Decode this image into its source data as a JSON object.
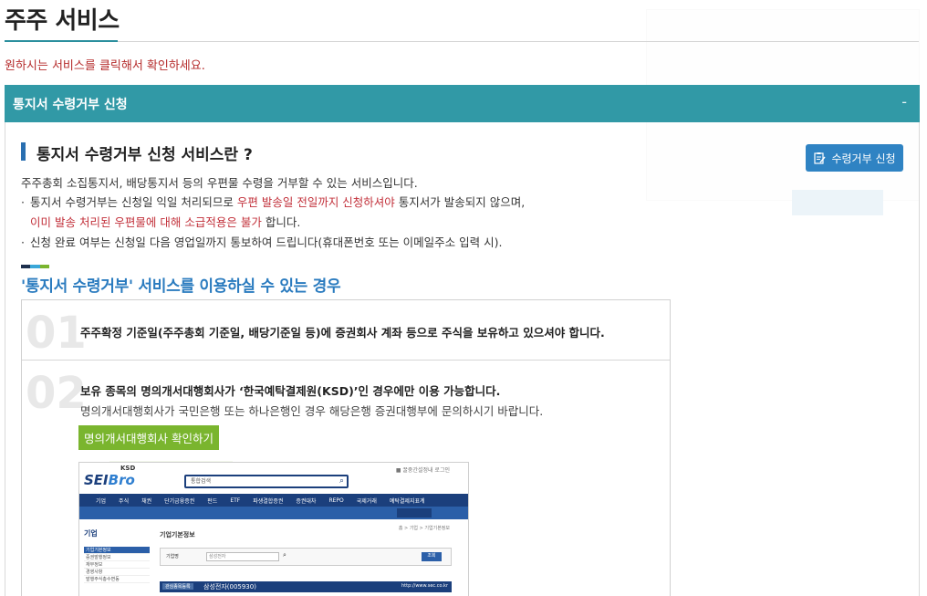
{
  "page": {
    "title": "주주 서비스",
    "instruction": "원하시는 서비스를 클릭해서 확인하세요."
  },
  "accordion": {
    "header": "통지서 수령거부 신청",
    "toggle": "-"
  },
  "section": {
    "title": "통지서 수령거부 신청 서비스란 ?",
    "apply_button": "수령거부 신청",
    "description": "주주총회 소집통지서, 배당통지서 등의 우편물 수령을 거부할 수 있는 서비스입니다.",
    "bullet1_pre": "통지서 수령거부는 신청일 익일 처리되므로 ",
    "bullet1_red": "우편 발송일 전일까지 신청하셔야",
    "bullet1_post": " 통지서가 발송되지 않으며,",
    "bullet1b_red": "이미 발송 처리된 우편물에 대해 소급적용은 불가",
    "bullet1b_post": " 합니다.",
    "bullet2": "신청 완료 여부는 신청일 다음 영업일까지 통보하여 드립니다(휴대폰번호 또는 이메일주소 입력 시).",
    "bullet_mark": "·"
  },
  "conditions": {
    "title": "'통지서 수령거부' 서비스를 이용하실 수 있는 경우",
    "items": [
      {
        "num": "01",
        "text": "주주확정 기준일(주주총회 기준일, 배당기준일 등)에 증권회사 계좌 등으로 주식을 보유하고 있으셔야 합니다."
      },
      {
        "num": "02",
        "text": "보유 종목의 명의개서대행회사가 ‘한국예탁결제원(KSD)’인 경우에만 이용 가능합니다.",
        "sub": "명의개서대행회사가 국민은행 또는 하나은행인 경우 해당은행 증권대행부에 문의하시기 바랍니다.",
        "button": "명의개서대행회사 확인하기"
      }
    ]
  },
  "seibro": {
    "logo_a": "SEI",
    "logo_b": "Bro",
    "ksd": "KSD",
    "search_label": "통합검색",
    "util": "■ 꿀중간설정내 로그인",
    "nav": [
      "기업",
      "주식",
      "채권",
      "단기금융증권",
      "펀드",
      "ETF",
      "파생결합증권",
      "증권대차",
      "REPO",
      "국제거래",
      "예탁결제지표계"
    ],
    "side_title": "기업",
    "side_items": [
      "기업기본정보",
      "증권발행정보",
      "재무정보",
      "경영사항",
      "발행주식총수변동"
    ],
    "main_title": "기업기본정보",
    "breadcrumb": "홈 > 기업 > 기업기본정보",
    "form_label": "기업명",
    "form_value": "삼성전자",
    "go": "조회",
    "bar_tag": "관심종목등록",
    "bar_name": "삼성전자(005930)",
    "bar_url": "http://www.sec.co.kr"
  },
  "colors": {
    "accent_teal": "#3199a6",
    "accent_blue": "#2f83c3",
    "accent_red": "#c2303a",
    "accent_green": "#7ab52e"
  }
}
